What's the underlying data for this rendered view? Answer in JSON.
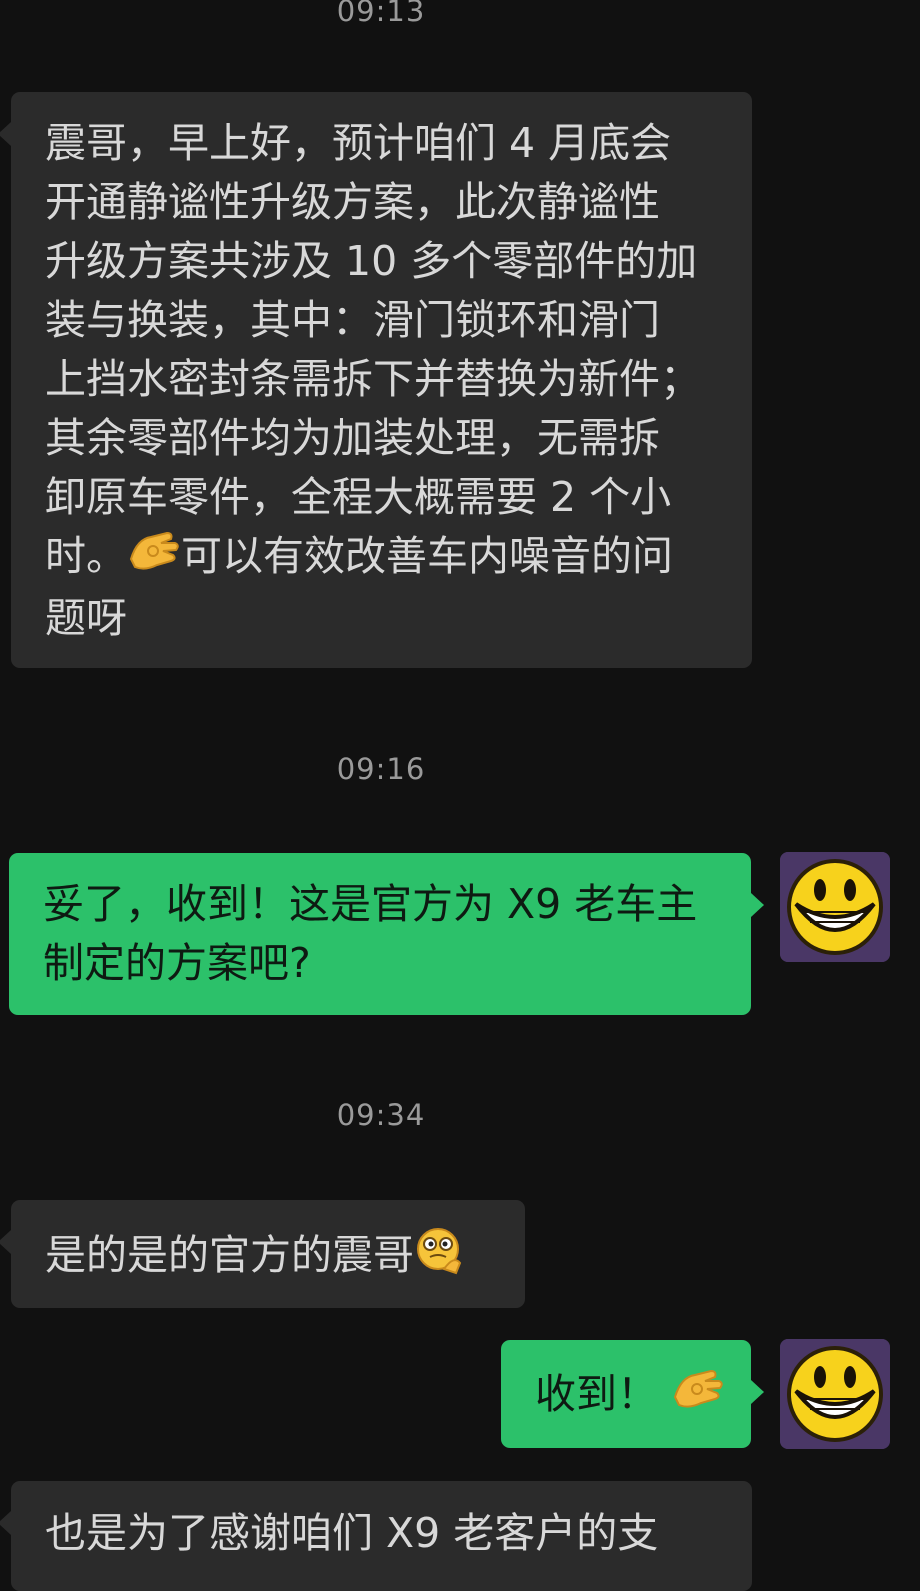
{
  "timestamps": [
    "09:13",
    "09:16",
    "09:34"
  ],
  "messages": [
    {
      "side": "in",
      "lines": [
        "震哥，早上好，预计咱们 4 月底会",
        "开通静谧性升级方案，此次静谧性",
        "升级方案共涉及 10 多个零部件的加",
        "装与换装，其中：滑门锁环和滑门",
        "上挡水密封条需拆下并替换为新件；",
        "其余零部件均为加装处理，无需拆",
        "卸原车零件，全程大概需要 2 个小",
        "时。",
        "可以有效改善车内噪音的问",
        "题呀"
      ],
      "emoji": "ok-hand-emoji"
    },
    {
      "side": "out",
      "lines": [
        "妥了，收到！这是官方为 X9 老车主",
        "制定的方案吧?"
      ]
    },
    {
      "side": "in",
      "lines": [
        "是的是的官方的震哥"
      ],
      "emoji": "thinking-face-emoji"
    },
    {
      "side": "out",
      "lines": [
        "收到！"
      ],
      "emoji": "ok-hand-emoji"
    },
    {
      "side": "in",
      "lines": [
        "也是为了感谢咱们 X9 老客户的支"
      ]
    }
  ],
  "colors": {
    "background": "#111111",
    "incoming_bubble": "#2b2b2b",
    "outgoing_bubble": "#2cc16a",
    "timestamp_text": "#9a9a9a"
  },
  "avatar": {
    "icon": "grinning-smiley-avatar"
  }
}
